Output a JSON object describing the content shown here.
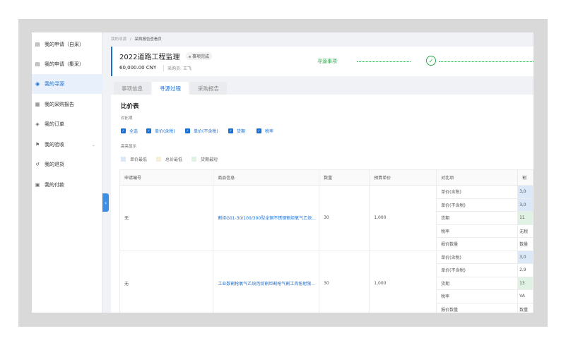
{
  "sidebar": {
    "items": [
      {
        "label": "我的申请（自采）",
        "icon": "document-icon"
      },
      {
        "label": "我的申请（集采）",
        "icon": "document-icon"
      },
      {
        "label": "我的寻源",
        "icon": "target-icon"
      },
      {
        "label": "我的采购报告",
        "icon": "report-icon"
      },
      {
        "label": "我的订单",
        "icon": "box-icon"
      },
      {
        "label": "我的验收",
        "icon": "flag-icon"
      },
      {
        "label": "我的退货",
        "icon": "return-icon"
      },
      {
        "label": "我的付款",
        "icon": "payment-icon"
      }
    ]
  },
  "breadcrumb": {
    "parent": "我的寻源",
    "separator": "/",
    "current": "采购报告查看页"
  },
  "header": {
    "title": "2022道路工程监理",
    "status": "事项完成",
    "amount": "60,000.00 CNY",
    "buyer_label": "采购员:",
    "buyer": "王飞",
    "step_label": "寻源事项"
  },
  "tabs": [
    "事项信息",
    "寻源过程",
    "采购报告"
  ],
  "section": {
    "title": "比价表",
    "compare_label": "对比项",
    "highlight_label": "高亮显示"
  },
  "compare_options": [
    "全选",
    "单价(含税)",
    "单价(不含税)",
    "货期",
    "税率"
  ],
  "highlight_options": [
    {
      "label": "单价最低",
      "color": "#dbe8f8"
    },
    {
      "label": "总价最低",
      "color": "#f7efd6"
    },
    {
      "label": "货期最短",
      "color": "#dff2e3"
    }
  ],
  "table": {
    "headers": [
      "申请编号",
      "商品信息",
      "数量",
      "预算单价",
      "对比项",
      "割"
    ],
    "rows": [
      {
        "apply_no": "无",
        "product": "割炬G01-30/100/300型全铜不锈钢割炬氧气乙炔...",
        "qty": "30",
        "budget": "1,000",
        "items": [
          "单价(含税)",
          "单价(不含税)",
          "货期",
          "税率",
          "报价数量"
        ],
        "values": [
          "3,0",
          "3,0",
          "11",
          "无税",
          "数量"
        ]
      },
      {
        "apply_no": "无",
        "product": "工业数割枪氧气乙炔丙烷割炬割枪气割工具抢射限...",
        "qty": "30",
        "budget": "1,000",
        "items": [
          "单价(含税)",
          "单价(不含税)",
          "货期",
          "税率",
          "报价数量"
        ],
        "values": [
          "3,0",
          "2,9",
          "13",
          "VA",
          "数量"
        ]
      }
    ]
  }
}
